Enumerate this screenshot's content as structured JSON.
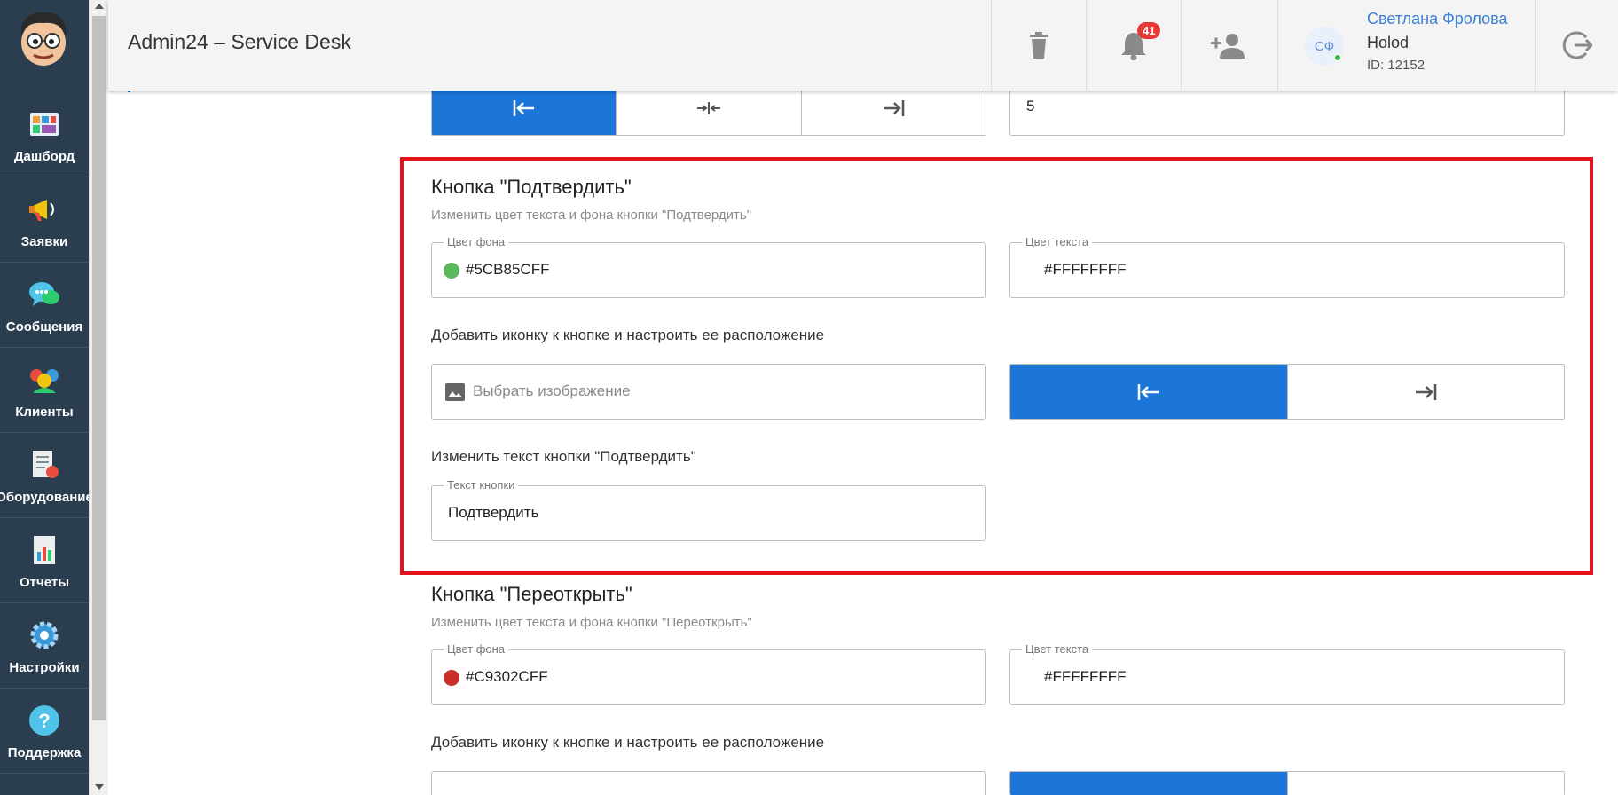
{
  "sidebar": {
    "items": [
      {
        "label": "Дашборд",
        "icon": "dashboard-icon"
      },
      {
        "label": "Заявки",
        "icon": "megaphone-icon"
      },
      {
        "label": "Сообщения",
        "icon": "chat-icon"
      },
      {
        "label": "Клиенты",
        "icon": "clients-icon"
      },
      {
        "label": "Оборудование",
        "icon": "equipment-icon"
      },
      {
        "label": "Отчеты",
        "icon": "reports-icon"
      },
      {
        "label": "Настройки",
        "icon": "gear-icon"
      },
      {
        "label": "Поддержка",
        "icon": "help-icon"
      }
    ]
  },
  "header": {
    "title": "Admin24 – Service Desk",
    "notifications_count": "41",
    "user": {
      "initials": "СФ",
      "name": "Светлана Фролова",
      "company": "Holod",
      "id": "ID: 12152"
    }
  },
  "top_partial": {
    "input_value": "5"
  },
  "confirm_section": {
    "title": "Кнопка \"Подтвердить\"",
    "subtitle": "Изменить цвет текста и фона кнопки \"Подтвердить\"",
    "bg_color_label": "Цвет фона",
    "bg_color_value": "#5CB85CFF",
    "bg_swatch": "#5cb85c",
    "text_color_label": "Цвет текста",
    "text_color_value": "#FFFFFFFF",
    "icon_label": "Добавить иконку к кнопке и настроить ее расположение",
    "image_placeholder": "Выбрать изображение",
    "change_text_label": "Изменить текст кнопки \"Подтвердить\"",
    "button_text_label": "Текст кнопки",
    "button_text_value": "Подтвердить"
  },
  "reopen_section": {
    "title": "Кнопка \"Переоткрыть\"",
    "subtitle": "Изменить цвет текста и фона кнопки \"Переоткрыть\"",
    "bg_color_label": "Цвет фона",
    "bg_color_value": "#C9302CFF",
    "bg_swatch": "#c9302c",
    "text_color_label": "Цвет текста",
    "text_color_value": "#FFFFFFFF",
    "icon_label": "Добавить иконку к кнопке и настроить ее расположение"
  },
  "colors": {
    "accent": "#1c75d8",
    "sidebar": "#2b3e50",
    "highlight": "#e3141b"
  }
}
